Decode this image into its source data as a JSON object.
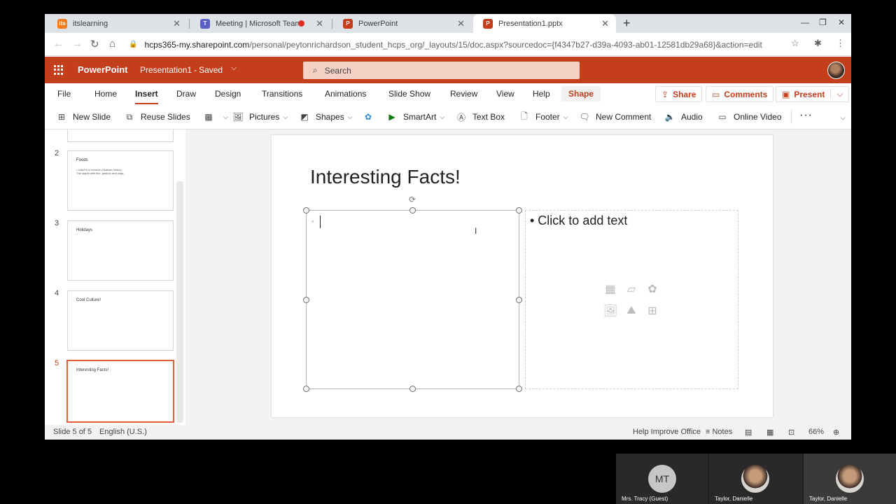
{
  "browser": {
    "tabs": [
      {
        "title": "itslearning",
        "favicon": "itslearning-icon",
        "active": false
      },
      {
        "title": "Meeting | Microsoft Teams",
        "favicon": "teams-icon",
        "recording": true,
        "active": false
      },
      {
        "title": "PowerPoint",
        "favicon": "powerpoint-icon",
        "active": false
      },
      {
        "title": "Presentation1.pptx",
        "favicon": "powerpoint-icon",
        "active": true
      }
    ],
    "url_host": "hcps365-my.sharepoint.com",
    "url_path": "/personal/peytonrichardson_student_hcps_org/_layouts/15/doc.aspx?sourcedoc={f4347b27-d39a-4093-ab01-12581db29a68}&action=edit"
  },
  "office": {
    "app_name": "PowerPoint",
    "doc_title": "Presentation1",
    "doc_status": "Saved",
    "search_placeholder": "Search",
    "accent_color": "#c43e1c"
  },
  "ribbon": {
    "tabs": [
      "File",
      "Home",
      "Insert",
      "Draw",
      "Design",
      "Transitions",
      "Animations",
      "Slide Show",
      "Review",
      "View",
      "Help",
      "Shape"
    ],
    "active_tab": "Insert",
    "share": "Share",
    "comments": "Comments",
    "present": "Present",
    "commands": {
      "new_slide": "New Slide",
      "reuse_slides": "Reuse Slides",
      "pictures": "Pictures",
      "shapes": "Shapes",
      "smartart": "SmartArt",
      "text_box": "Text Box",
      "footer": "Footer",
      "new_comment": "New Comment",
      "audio": "Audio",
      "online_video": "Online Video"
    }
  },
  "thumbnails": [
    {
      "num": "2",
      "title": "Foods",
      "body": "• Jollof is a common Ghanian history. The staple with fine, gridtors and vegs."
    },
    {
      "num": "3",
      "title": "Holidays",
      "body": ""
    },
    {
      "num": "4",
      "title": "Cool Culture!",
      "body": ""
    },
    {
      "num": "5",
      "title": "Interesting Facts!",
      "body": ""
    }
  ],
  "slide": {
    "title": "Interesting Facts!",
    "placeholder": "• Click to add text"
  },
  "status": {
    "slide_count": "Slide 5 of 5",
    "language": "English (U.S.)",
    "help_improve": "Help Improve Office",
    "notes": "Notes",
    "zoom": "66%"
  },
  "meeting": {
    "participants": [
      {
        "initials": "MT",
        "name": "Mrs. Tracy (Guest)"
      },
      {
        "name": "Taylor, Danielle"
      },
      {
        "name": "Taylor, Danielle"
      }
    ]
  }
}
